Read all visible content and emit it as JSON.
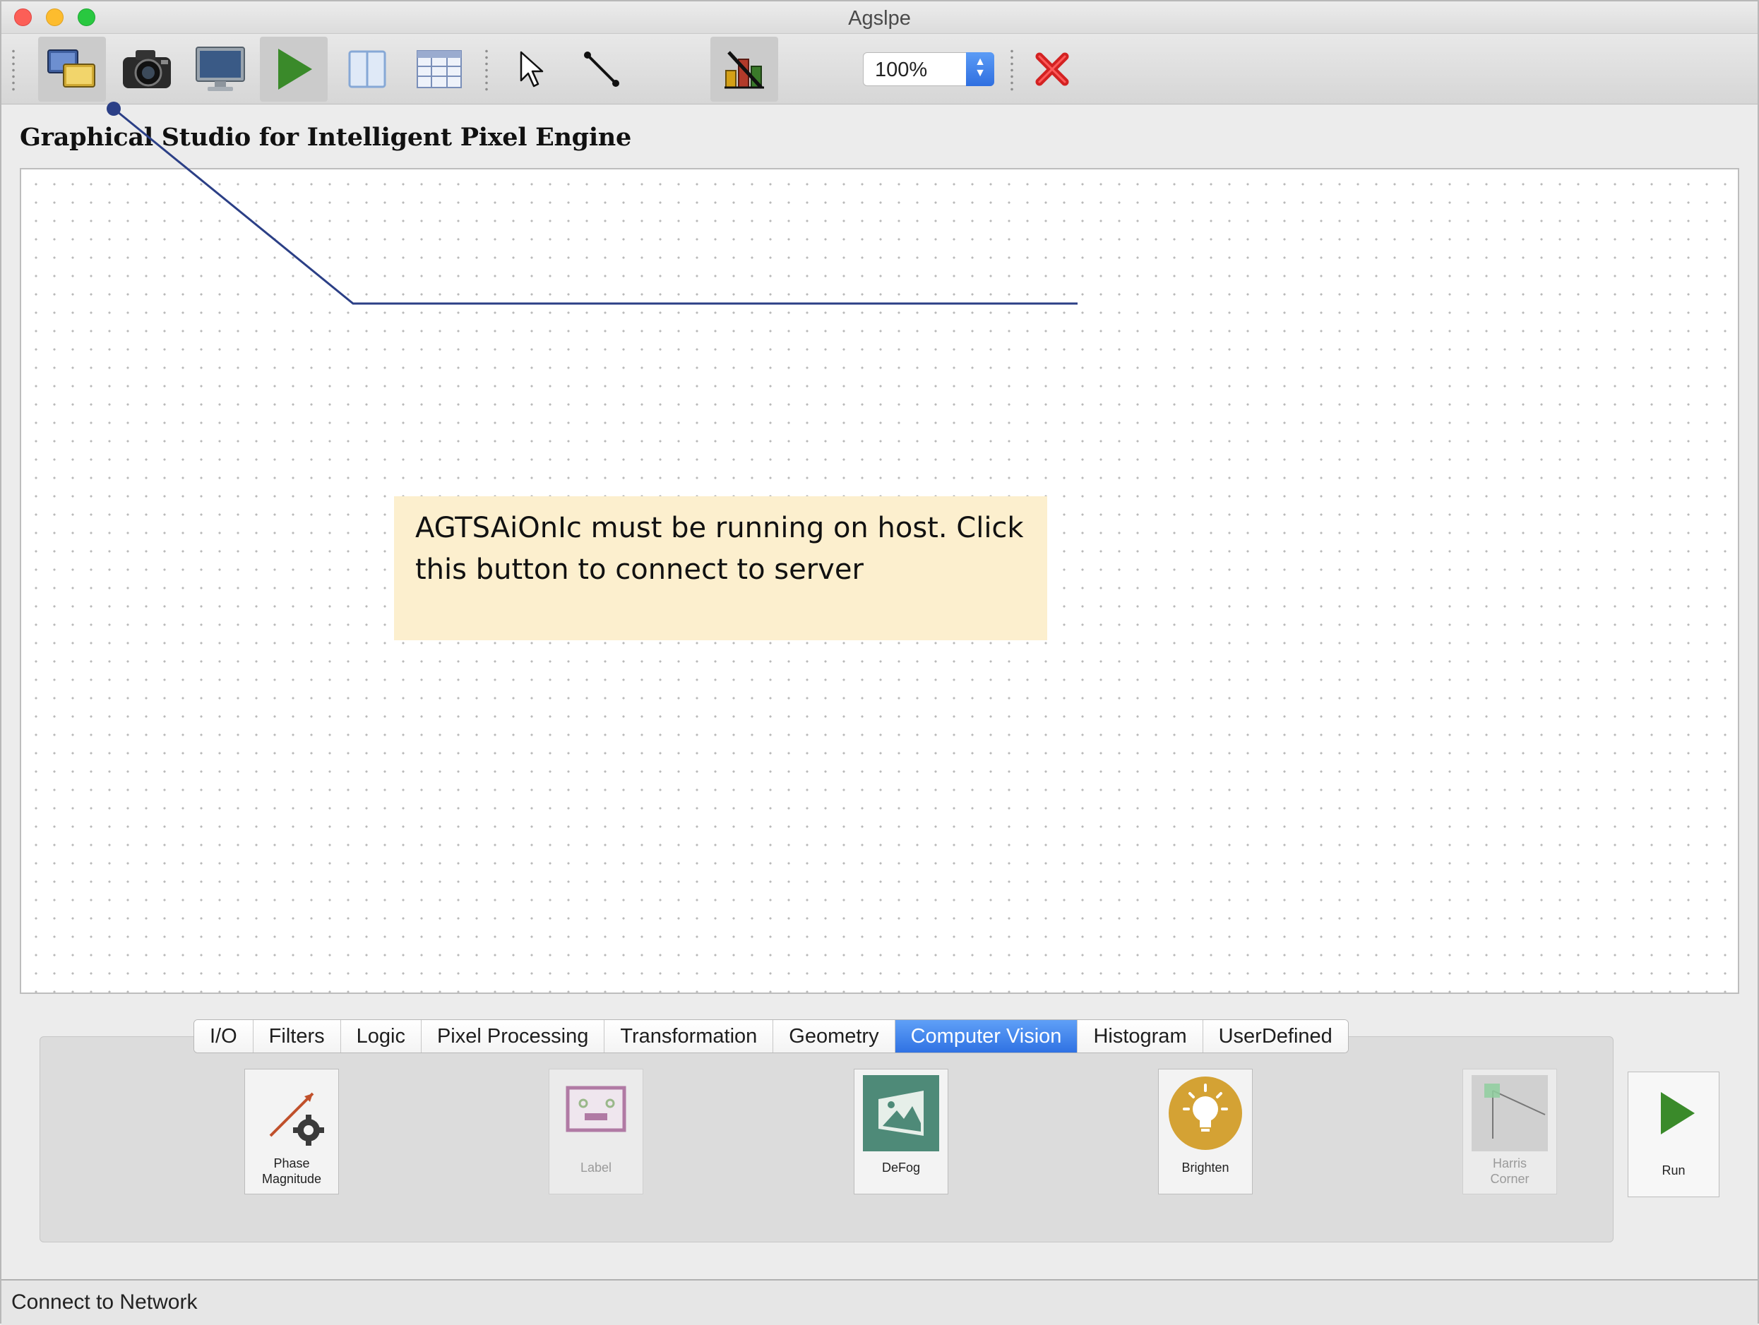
{
  "window": {
    "title": "Agslpe"
  },
  "toolbar": {
    "zoom_value": "100%",
    "buttons": [
      {
        "name": "connect-network",
        "icon": "windows-connect-icon"
      },
      {
        "name": "camera",
        "icon": "camera-icon"
      },
      {
        "name": "display",
        "icon": "monitor-icon"
      },
      {
        "name": "run",
        "icon": "play-icon"
      },
      {
        "name": "split-view",
        "icon": "split-view-icon"
      },
      {
        "name": "table-view",
        "icon": "table-icon"
      },
      {
        "name": "select-tool",
        "icon": "pointer-icon"
      },
      {
        "name": "connect-tool",
        "icon": "connector-icon"
      },
      {
        "name": "disconnect",
        "icon": "disconnect-blocks-icon"
      },
      {
        "name": "stop",
        "icon": "red-x-icon"
      }
    ]
  },
  "heading": "Graphical Studio for Intelligent Pixel Engine",
  "canvas": {
    "callout_text": "AGTSAiOnIc must be running on host. Click this button to connect to server"
  },
  "palette": {
    "tabs": [
      {
        "label": "I/O",
        "active": false
      },
      {
        "label": "Filters",
        "active": false
      },
      {
        "label": "Logic",
        "active": false
      },
      {
        "label": "Pixel Processing",
        "active": false
      },
      {
        "label": "Transformation",
        "active": false
      },
      {
        "label": "Geometry",
        "active": false
      },
      {
        "label": "Computer Vision",
        "active": true
      },
      {
        "label": "Histogram",
        "active": false
      },
      {
        "label": "UserDefined",
        "active": false
      }
    ],
    "tools": [
      {
        "label": "Phase\nMagnitude",
        "icon": "phase-magnitude-icon",
        "enabled": true
      },
      {
        "label": "Label",
        "icon": "label-icon",
        "enabled": false
      },
      {
        "label": "DeFog",
        "icon": "defog-icon",
        "enabled": true
      },
      {
        "label": "Brighten",
        "icon": "lightbulb-icon",
        "enabled": true
      },
      {
        "label": "Harris\nCorner",
        "icon": "harris-corner-icon",
        "enabled": false
      },
      {
        "label": "Run",
        "icon": "play-icon",
        "enabled": true
      }
    ]
  },
  "statusbar": {
    "text": "Connect to Network"
  },
  "colors": {
    "accent_blue": "#2f72e3",
    "callout_bg": "#fcefce",
    "connector_line": "#2b3f86",
    "run_green": "#3a8a2a",
    "stop_red": "#d32222",
    "brighten_gold": "#d4a234",
    "defog_teal": "#4e8a78"
  }
}
